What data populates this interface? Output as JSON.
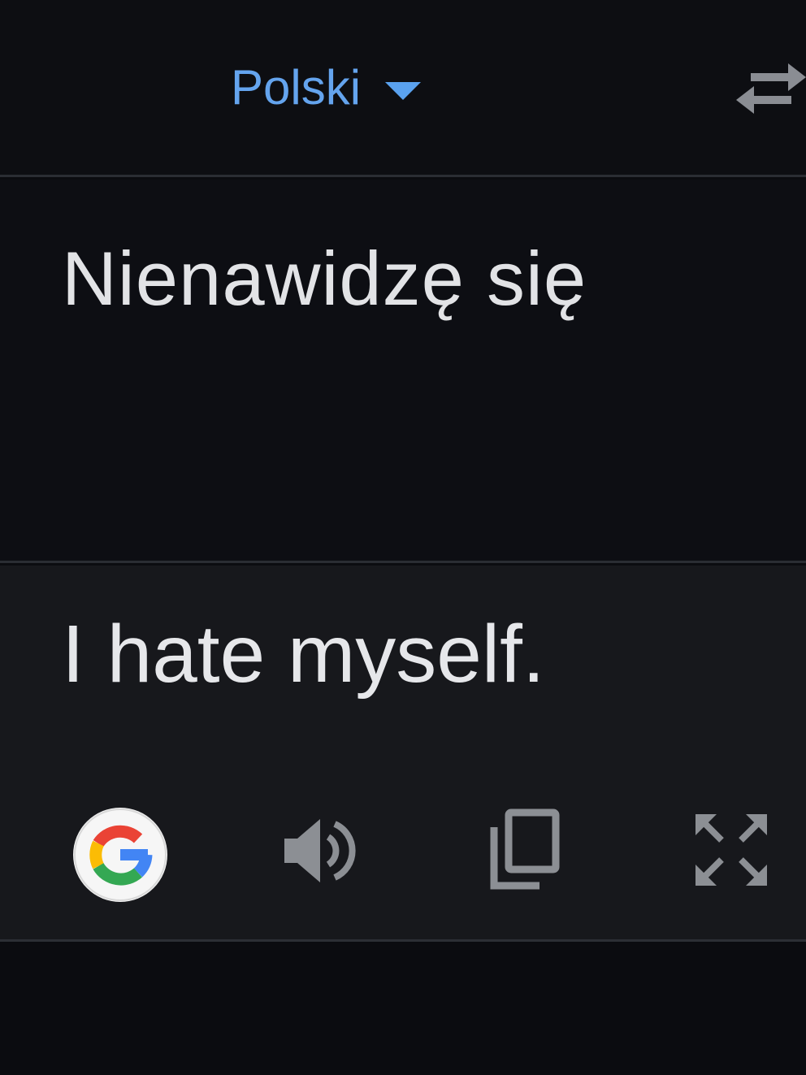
{
  "language_bar": {
    "source_language": "Polski",
    "dropdown_icon": "caret-down-icon",
    "swap_icon": "swap-languages-icon",
    "accent_color": "#64a4ee"
  },
  "source": {
    "text": "Nienawidzę się"
  },
  "result": {
    "text": "I hate myself.",
    "actions": {
      "google_icon": "google-logo-icon",
      "speak_icon": "speaker-icon",
      "copy_icon": "copy-icon",
      "fullscreen_icon": "fullscreen-icon"
    }
  }
}
